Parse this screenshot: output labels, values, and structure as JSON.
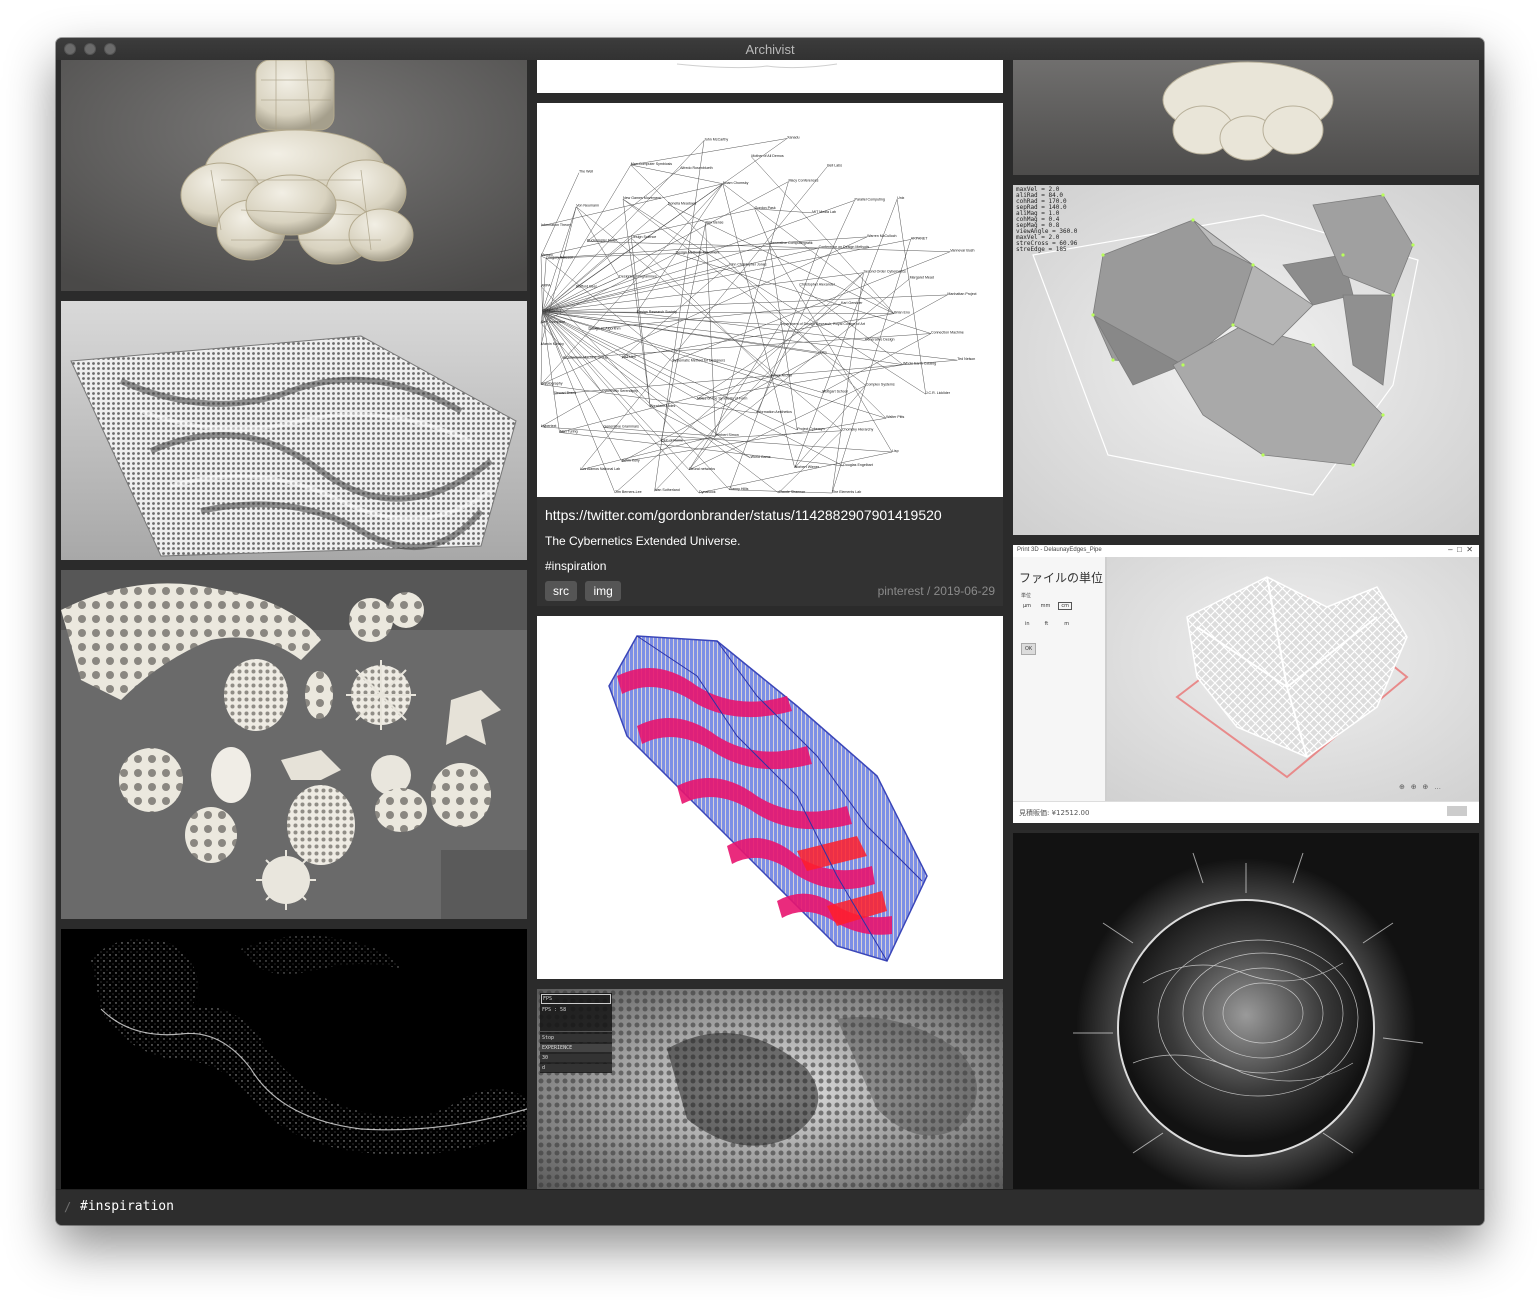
{
  "window": {
    "title": "Archivist"
  },
  "focused_card": {
    "url": "https://twitter.com/gordonbrander/status/1142882907901419520",
    "description": "The Cybernetics Extended Universe.",
    "tag": "#inspiration",
    "buttons": {
      "src": "src",
      "img": "img"
    },
    "meta": "pinterest / 2019-06-29"
  },
  "debug_panel": {
    "lines": [
      "maxVel = 2.0",
      "aliRad = 84.0",
      "cohRad = 170.0",
      "sepRad = 140.0",
      "aliMag = 1.0",
      "cohMag = 0.4",
      "sepMag = 0.8",
      "viewAngle = 360.0",
      "maxVel = 2.0",
      "streCross = 60.96",
      "streEdge = 185"
    ]
  },
  "print_dialog": {
    "title": "Print 3D - DelaunayEdges_Pipe",
    "heading": "ファイルの単位",
    "unit_label": "単位",
    "units_row1": [
      "μm",
      "mm",
      "cm"
    ],
    "units_row2": [
      "in",
      "ft",
      "m"
    ],
    "ok_label": "OK",
    "price": "見積販価: ¥12512.00"
  },
  "fps_panel": {
    "title": "FPS",
    "fps": "FPS : 58",
    "items": [
      "Stop",
      "EXPERIENCE",
      "30",
      "d"
    ]
  },
  "network": {
    "labels": [
      "Department of Design Research, Royal College of Art",
      "Systematic Method for Designers",
      "John Christopher Jones",
      "Bruce Archer",
      "Design Research Society",
      "Christopher Alexander",
      "Notes on the Synthesis of Form",
      "Design Methods Movement",
      "Ulm",
      "HfG Ulm",
      "Generative Computergrafik",
      "Information Aesthetics",
      "Designing Programmes",
      "Karl Gerstner",
      "Abraham Moles",
      "Max Bense",
      "Stuttgart School",
      "Design as Algorithm",
      "Conference on Design Methods",
      "Herbert Simon",
      "Design Science",
      "Generative Design",
      "Cybernetic Serendipity",
      "Gordon Pask",
      "Project Cybersyn",
      "Stafford Beer",
      "Second Order Cybernetics",
      "Club of Rome",
      "Donella Meadows",
      "Complex Systems",
      "Architecture Machine Group",
      "MIT Media Lab",
      "World Game",
      "Buckminster Fuller",
      "Brian Eno",
      "Generative Grammars",
      "Noam Chomsky",
      "Chomsky Hierarchy",
      "Cybernetics",
      "Warren McCulloch",
      "Neural networks",
      "New Games Movement",
      "Whole Earth Catalog",
      "Stewart Brand",
      "Macy Conferences",
      "Norbert Wiener",
      "Gregory Bateson",
      "Margaret Mead",
      "Kevin Kelly",
      "Alfredo Rosenblueth",
      "Walter Pitts",
      "Marvin Minsky",
      "Parallel Computing",
      "Danny Hillis",
      "Von Neumann",
      "Connection Machine",
      "Alan Turing",
      "Mother of All Demos",
      "Douglas Engelbart",
      "ARPA",
      "ARPANET",
      "Ivan Sutherland",
      "Man-Computer Symbiosis",
      "J.C.R. Licklider",
      "Cryptography",
      "Bell Labs",
      "Claude Shannon",
      "Information Theory",
      "Manhattan Project",
      "Los Alamos National Lab",
      "John McCarthy",
      "Lisp",
      "Ken Thompson",
      "Unix",
      "DynaBook",
      "The Well",
      "Ted Nelson",
      "Hypertext",
      "Xanadu",
      "The Elements Lab",
      "Memex",
      "Vannevar Bush",
      "Tim Berners-Lee"
    ]
  }
}
